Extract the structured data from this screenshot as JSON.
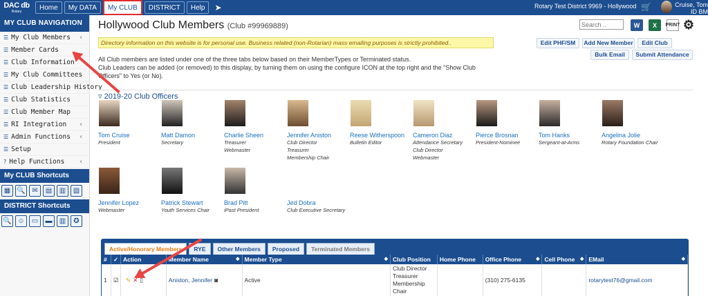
{
  "app": {
    "logo_line1": "DAC db",
    "logo_line2": "Rotary",
    "nav_tabs": [
      "Home",
      "My DATA",
      "My CLUB",
      "DISTRICT",
      "Help"
    ],
    "district": "Rotary Test District 9969 - Hollywood",
    "user_name": "Cruise, Tom",
    "user_meta": "ID BM"
  },
  "sidebar": {
    "header": "MY CLUB NAVIGATION",
    "items": [
      "My Club Members",
      "Member Cards",
      "Club Information",
      "My Club Committees",
      "Club Leadership History",
      "Club Statistics",
      "Club Member Map",
      "RI Integration",
      "Admin Functions",
      "Setup",
      "Help Functions"
    ],
    "club_shortcuts_header": "My CLUB Shortcuts",
    "district_shortcuts_header": "DISTRICT Shortcuts"
  },
  "page": {
    "title": "Hollywood Club Members",
    "club_id": "(Club #99969889)",
    "search_placeholder": "Search ..",
    "tool_word": "W",
    "tool_excel": "X",
    "tool_print": "PRINT",
    "notice": "Directory information on this website is for personal use. Business related (non-Rotarian) mass emailing purposes is strictly prohibited..",
    "desc_1": "All Club members are listed under one of the three tabs below based on their MemberTypes or Terminated status.",
    "desc_2": "Club Leaders can be added (or removed) to this display, by turning them on using the configure ICON at the top right and the \"Show Club",
    "desc_3": "Officers\" to Yes (or No).",
    "buttons": {
      "edit_phf": "Edit PHF/SM",
      "add_member": "Add New Member",
      "edit_club": "Edit Club",
      "bulk_email": "Bulk Email",
      "submit_attendance": "Submit Attendance"
    }
  },
  "officers": {
    "section_title": "2019-20 Club Officers",
    "list": [
      {
        "name": "Tom Cruise",
        "roles": [
          "President"
        ]
      },
      {
        "name": "Matt Damon",
        "roles": [
          "Secretary"
        ]
      },
      {
        "name": "Charlie Sheen",
        "roles": [
          "Treasurer",
          "Webmaster"
        ]
      },
      {
        "name": "Jennifer Aniston",
        "roles": [
          "Club Director",
          "Treasurer",
          "Membership Chair"
        ]
      },
      {
        "name": "Reese Witherspoon",
        "roles": [
          "Bulletin Editor"
        ]
      },
      {
        "name": "Cameron Diaz",
        "roles": [
          "Attendance Secretary",
          "Club Director",
          "Webmaster"
        ]
      },
      {
        "name": "Pierce Brosnan",
        "roles": [
          "President-Nominee"
        ]
      },
      {
        "name": "Tom Hanks",
        "roles": [
          "Sergeant-at-Arms"
        ]
      },
      {
        "name": "Angelina Jolie",
        "roles": [
          "Rotary Foundation Chair"
        ]
      },
      {
        "name": "Jennifer Lopez",
        "roles": [
          "Webmaster"
        ]
      },
      {
        "name": "Patrick Stewart",
        "roles": [
          "Youth Services Chair"
        ]
      },
      {
        "name": "Brad Pitt",
        "roles": [
          "iPast President"
        ]
      },
      {
        "name": "Jed Dobra",
        "roles": [
          "Club Executive Secretary"
        ]
      }
    ]
  },
  "members_table": {
    "tabs": [
      "Active/Honorary Members",
      "RYE",
      "Other Members",
      "Proposed",
      "Terminated Members"
    ],
    "columns": [
      "#",
      "✓",
      "Action",
      "Member Name",
      "Member Type",
      "Club Position",
      "Home Phone",
      "Office Phone",
      "Cell Phone",
      "EMail"
    ],
    "rows": [
      {
        "num": "1",
        "name": "Aniston, Jennifer",
        "type": "Active",
        "position": "Club Director Treasurer Membership Chair",
        "home_phone": "",
        "office_phone": "(310) 275-6135",
        "cell_phone": "",
        "email": "rotarytest76@gmail.com"
      }
    ]
  },
  "colors": {
    "brand_blue": "#1b4d8f",
    "annotation_red": "#e84545",
    "notice_yellow": "#fcf8a8",
    "active_tab_orange": "#e47b13"
  }
}
